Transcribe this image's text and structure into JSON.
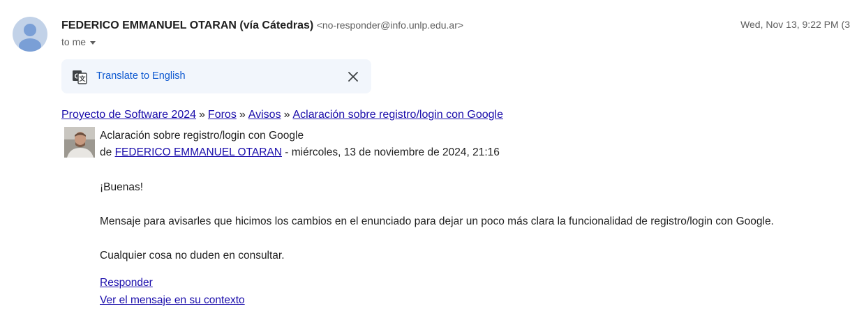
{
  "header": {
    "sender_name": "FEDERICO EMMANUEL OTARAN (vía Cátedras)",
    "sender_email": "<no-responder@info.unlp.edu.ar>",
    "timestamp": "Wed, Nov 13, 9:22 PM (3",
    "to_label": "to me"
  },
  "translate": {
    "label": "Translate to English"
  },
  "breadcrumb": {
    "items": [
      "Proyecto de Software 2024",
      "Foros",
      "Avisos",
      "Aclaración sobre registro/login con Google"
    ],
    "separator": "»"
  },
  "post": {
    "subject": "Aclaración sobre registro/login con Google",
    "by_prefix": "de",
    "author": "FEDERICO EMMANUEL OTARAN",
    "date_text": " - miércoles, 13 de noviembre de 2024, 21:16",
    "paragraphs": [
      "¡Buenas!",
      "Mensaje para avisarles que hicimos los cambios en el enunciado para dejar un poco más clara la funcionalidad de registro/login con Google.",
      "Cualquier cosa no duden en consultar."
    ],
    "reply_link": "Responder",
    "context_link": "Ver el mensaje en su contexto"
  },
  "colors": {
    "link": "#1a0dab",
    "translate_link": "#0b57d0",
    "translate_bg": "#f2f6fc",
    "avatar_bg": "#c2d2e8",
    "avatar_fg": "#7a9fd6"
  }
}
